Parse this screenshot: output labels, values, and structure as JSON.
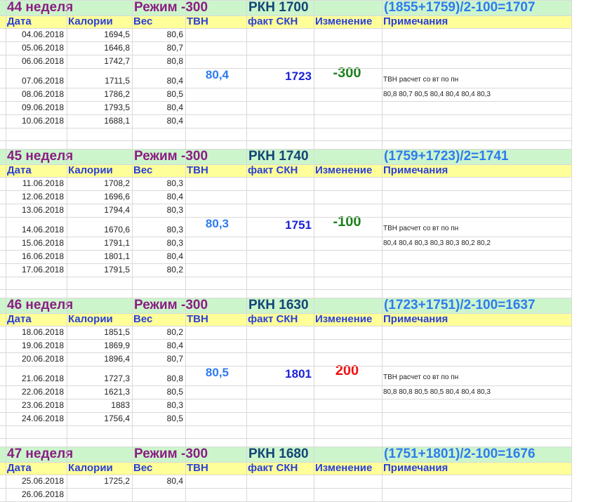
{
  "headers": {
    "date": "Дата",
    "calories": "Калории",
    "weight": "Вес",
    "tvn": "ТВН",
    "fact_skn": "факт СКН",
    "change": "Изменение",
    "notes": "Примечания"
  },
  "colors": {
    "week_bg": "#ccf5cc",
    "header_bg": "#ffff99",
    "week_label": "#8b1d84",
    "rkn_label": "#124578",
    "formula": "#2e7bf0",
    "header_text": "#2a3fd8",
    "tvn_value": "#2e7bf0",
    "skn_value": "#1b22d8",
    "change_negative": "#1e7f1e",
    "change_positive": "#ee1111",
    "grid": "#d9d9d9"
  },
  "weeks": [
    {
      "week": "44  неделя",
      "mode": "Режим -300",
      "rkn": "РКН  1700",
      "formula": "(1855+1759)/2-100=1707",
      "rows": [
        {
          "date": "04.06.2018",
          "cal": "1694,5",
          "wt": "80,6"
        },
        {
          "date": "05.06.2018",
          "cal": "1646,8",
          "wt": "80,7"
        },
        {
          "date": "06.06.2018",
          "cal": "1742,7",
          "wt": "80,8"
        },
        {
          "date": "07.06.2018",
          "cal": "1711,5",
          "wt": "80,4"
        },
        {
          "date": "08.06.2018",
          "cal": "1786,2",
          "wt": "80,5"
        },
        {
          "date": "09.06.2018",
          "cal": "1793,5",
          "wt": "80,4"
        },
        {
          "date": "10.06.2018",
          "cal": "1688,1",
          "wt": "80,4"
        }
      ],
      "tvn": "80,4",
      "skn": "1723",
      "change": "-300",
      "change_sign": "negative",
      "note1": "ТВН расчет со вт по пн",
      "note2": "80,8  80,7  80,5  80,4  80,4  80,4  80,3"
    },
    {
      "week": "45  неделя",
      "mode": "Режим -300",
      "rkn": "РКН  1740",
      "formula": "(1759+1723)/2=1741",
      "rows": [
        {
          "date": "11.06.2018",
          "cal": "1708,2",
          "wt": "80,3"
        },
        {
          "date": "12.06.2018",
          "cal": "1696,6",
          "wt": "80,4"
        },
        {
          "date": "13.06.2018",
          "cal": "1794,4",
          "wt": "80,3"
        },
        {
          "date": "14.06.2018",
          "cal": "1670,6",
          "wt": "80,3"
        },
        {
          "date": "15.06.2018",
          "cal": "1791,1",
          "wt": "80,3"
        },
        {
          "date": "16.06.2018",
          "cal": "1801,1",
          "wt": "80,4"
        },
        {
          "date": "17.06.2018",
          "cal": "1791,5",
          "wt": "80,2"
        }
      ],
      "tvn": "80,3",
      "skn": "1751",
      "change": "-100",
      "change_sign": "negative",
      "note1": "ТВН расчет со вт по пн",
      "note2": "80,4  80,4  80,3  80,3  80,3  80,2  80,2"
    },
    {
      "week": "46  неделя",
      "mode": "Режим -300",
      "rkn": "РКН  1630",
      "formula": "(1723+1751)/2-100=1637",
      "rows": [
        {
          "date": "18.06.2018",
          "cal": "1851,5",
          "wt": "80,2"
        },
        {
          "date": "19.06.2018",
          "cal": "1869,9",
          "wt": "80,4"
        },
        {
          "date": "20.06.2018",
          "cal": "1896,4",
          "wt": "80,7"
        },
        {
          "date": "21.06.2018",
          "cal": "1727,3",
          "wt": "80,8"
        },
        {
          "date": "22.06.2018",
          "cal": "1621,3",
          "wt": "80,5"
        },
        {
          "date": "23.06.2018",
          "cal": "1883",
          "wt": "80,3"
        },
        {
          "date": "24.06.2018",
          "cal": "1756,4",
          "wt": "80,5"
        }
      ],
      "tvn": "80,5",
      "skn": "1801",
      "change": "200",
      "change_sign": "positive",
      "note1": "ТВН расчет со вт по пн",
      "note2": "80,8  80,8  80,5  80,5  80,4  80,4  80,3"
    },
    {
      "week": "47  неделя",
      "mode": "Режим -300",
      "rkn": "РКН  1680",
      "formula": "(1751+1801)/2-100=1676",
      "rows": [
        {
          "date": "25.06.2018",
          "cal": "1725,2",
          "wt": "80,4"
        },
        {
          "date": "26.06.2018",
          "cal": "",
          "wt": ""
        }
      ]
    }
  ]
}
